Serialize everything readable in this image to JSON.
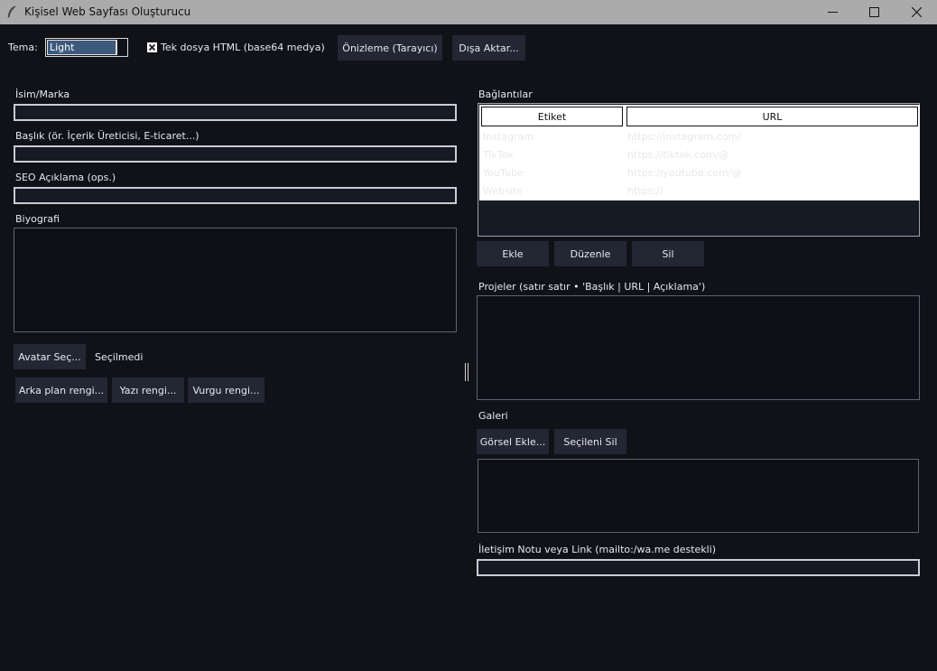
{
  "window": {
    "title": "Kişisel Web Sayfası Oluşturucu",
    "controls": [
      "minimize-icon",
      "maximize-icon",
      "close-icon"
    ],
    "app_icon": "feather-icon"
  },
  "toolbar": {
    "theme_label": "Tema:",
    "theme_value": "Light",
    "single_file_label": "Tek dosya HTML (base64 medya)",
    "single_file_checked": true,
    "preview_button": "Önizleme (Tarayıcı)",
    "export_button": "Dışa Aktar..."
  },
  "left": {
    "name_label": "İsim/Marka",
    "name_value": "",
    "headline_label": "Başlık (ör. İçerik Üreticisi, E-ticaret...)",
    "headline_value": "",
    "seo_label": "SEO Açıklama (ops.)",
    "seo_value": "",
    "bio_label": "Biyografi",
    "bio_value": "",
    "avatar_button": "Avatar Seç...",
    "avatar_status": "Seçilmedi",
    "bg_color_button": "Arka plan rengi...",
    "text_color_button": "Yazı rengi...",
    "accent_color_button": "Vurgu rengi..."
  },
  "right": {
    "links_label": "Bağlantılar",
    "links_columns": [
      "Etiket",
      "URL"
    ],
    "links_rows": [
      {
        "label": "Instagram",
        "url": "https://instagram.com/"
      },
      {
        "label": "TikTok",
        "url": "https://tiktok.com/@"
      },
      {
        "label": "YouTube",
        "url": "https://youtube.com/@"
      },
      {
        "label": "Website",
        "url": "https://"
      }
    ],
    "add_button": "Ekle",
    "edit_button": "Düzenle",
    "delete_button": "Sil",
    "projects_label": "Projeler (satır satır • 'Başlık | URL | Açıklama')",
    "projects_value": "",
    "gallery_label": "Galeri",
    "add_image_button": "Görsel Ekle...",
    "remove_selected_button": "Seçileni Sil",
    "contact_label": "İletişim Notu veya Link (mailto:/wa.me destekli)",
    "contact_value": ""
  },
  "colors": {
    "background": "#101218",
    "button": "#232734",
    "titlebar": "#ababab",
    "selection": "#3d5a7c"
  }
}
